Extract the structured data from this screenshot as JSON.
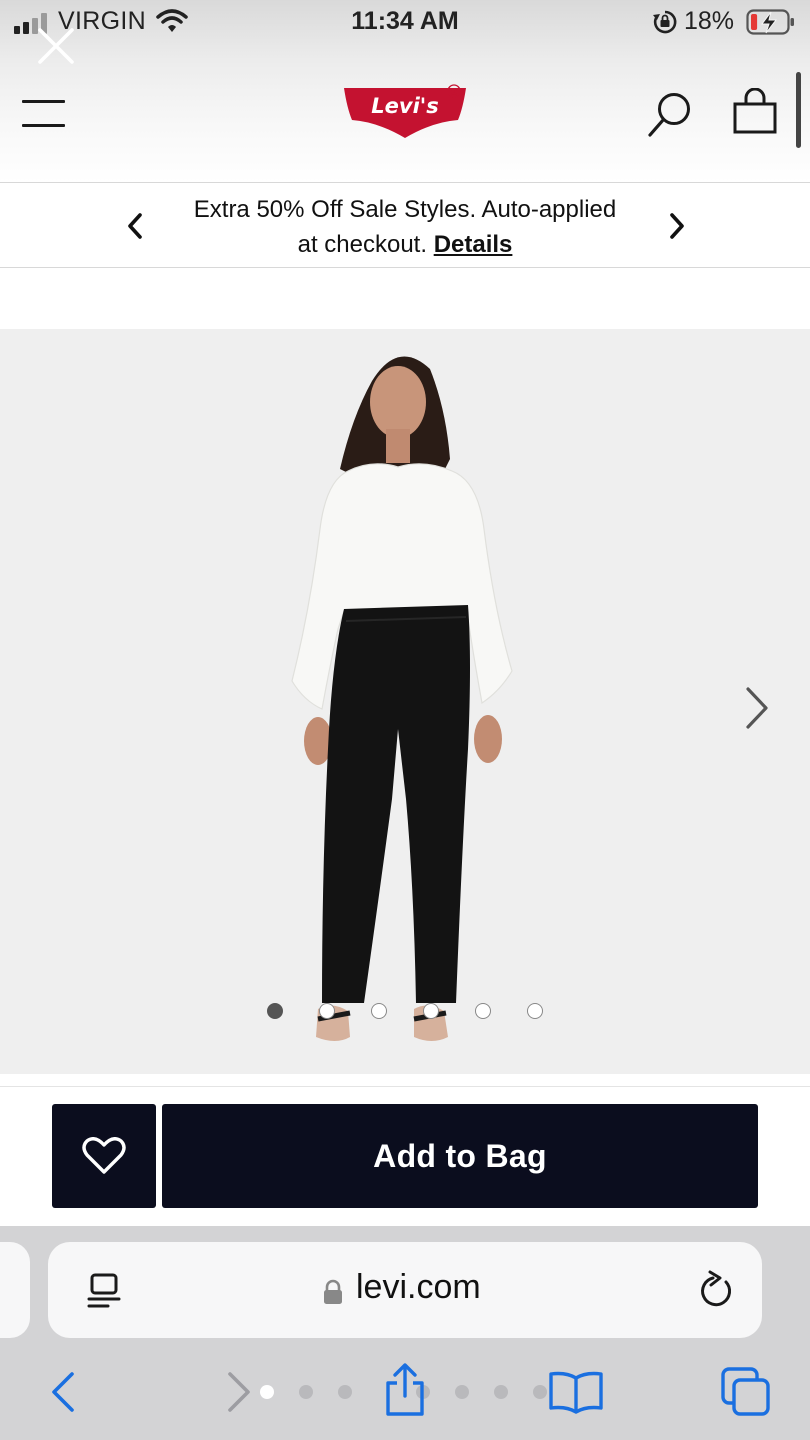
{
  "status_bar": {
    "carrier": "VIRGIN",
    "time": "11:34 AM",
    "battery_percent": "18%",
    "battery_level": 0.18,
    "signal_bars_active": 2,
    "icons": [
      "signal-icon",
      "wifi-icon",
      "rotation-lock-icon",
      "battery-charging-icon"
    ]
  },
  "header": {
    "brand": "Levi's",
    "brand_mark": "®",
    "icons": [
      "close-icon",
      "hamburger-menu-icon",
      "search-icon",
      "shopping-bag-icon"
    ]
  },
  "promo": {
    "line1": "Extra 50% Off Sale Styles. Auto-applied",
    "line2_prefix": "at checkout.",
    "link_label": "Details",
    "icons": [
      "chevron-left-icon",
      "chevron-right-icon"
    ]
  },
  "product": {
    "image_count": 6,
    "active_image_index": 0,
    "icons": [
      "chevron-right-icon"
    ]
  },
  "actions": {
    "add_to_bag_label": "Add to Bag",
    "icons": [
      "heart-icon"
    ]
  },
  "browser": {
    "url": "levi.com",
    "page_dot_count": 8,
    "active_page_dot": 0,
    "icons": [
      "reader-icon",
      "lock-icon",
      "reload-icon",
      "back-icon",
      "forward-icon",
      "share-icon",
      "bookmarks-icon",
      "tabs-icon"
    ]
  },
  "colors": {
    "brand_red": "#c41230",
    "button_navy": "#0b0d1e",
    "safari_blue": "#1a6fe0",
    "battery_red": "#e53935"
  }
}
